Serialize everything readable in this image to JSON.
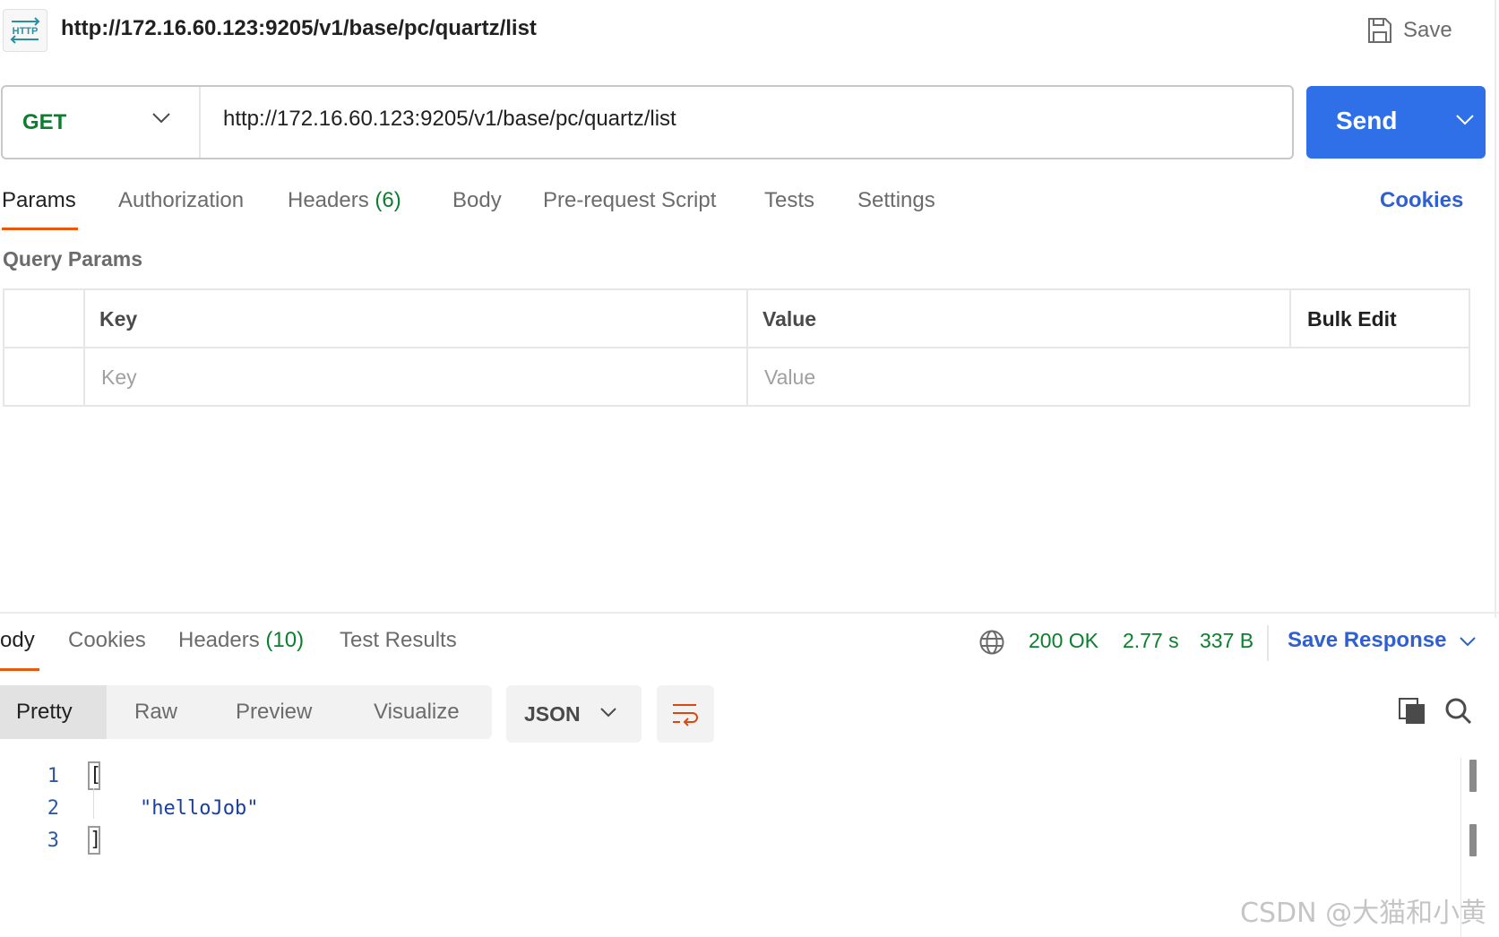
{
  "request": {
    "title": "http://172.16.60.123:9205/v1/base/pc/quartz/list",
    "badge_text": "HTTP",
    "save_label": "Save",
    "method": "GET",
    "url": "http://172.16.60.123:9205/v1/base/pc/quartz/list",
    "send_label": "Send"
  },
  "request_tabs": {
    "params": "Params",
    "authorization": "Authorization",
    "headers": "Headers",
    "headers_count": "(6)",
    "body": "Body",
    "pre_request": "Pre-request Script",
    "tests": "Tests",
    "settings": "Settings",
    "cookies": "Cookies"
  },
  "query_params": {
    "section_title": "Query Params",
    "col_key": "Key",
    "col_value": "Value",
    "bulk_edit": "Bulk Edit",
    "key_placeholder": "Key",
    "value_placeholder": "Value"
  },
  "response": {
    "tabs": {
      "body": "ody",
      "cookies": "Cookies",
      "headers": "Headers",
      "headers_count": "(10)",
      "test_results": "Test Results"
    },
    "status": "200 OK",
    "time": "2.77 s",
    "size": "337 B",
    "save_response": "Save Response",
    "formats": {
      "pretty": "Pretty",
      "raw": "Raw",
      "preview": "Preview",
      "visualize": "Visualize"
    },
    "language": "JSON",
    "lines": [
      {
        "no": "1",
        "text": "["
      },
      {
        "no": "2",
        "text": "\"helloJob\""
      },
      {
        "no": "3",
        "text": "]"
      }
    ]
  },
  "watermark": "CSDN @大猫和小黄",
  "colors": {
    "accent_blue": "#2f6fe8",
    "link_blue": "#2f5fd0",
    "success_green": "#0a7f2e",
    "active_tab_orange": "#e8590c"
  }
}
